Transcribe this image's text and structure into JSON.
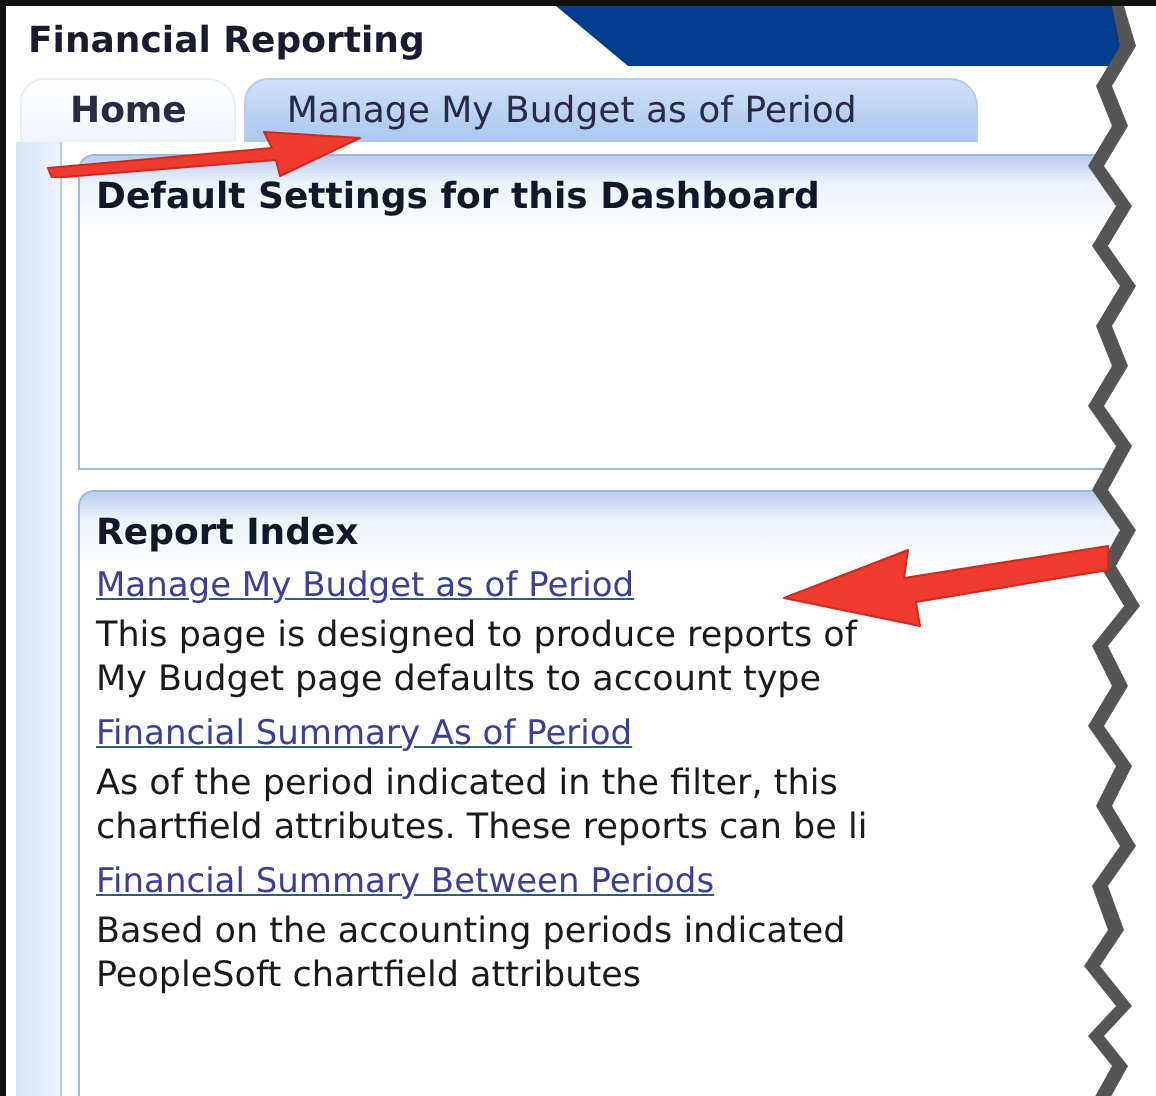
{
  "window": {
    "title": "Financial Reporting"
  },
  "tabs": [
    {
      "label": "Home",
      "selected": true
    },
    {
      "label": "Manage My Budget as of Period",
      "selected": false
    }
  ],
  "settings_panel": {
    "title": "Default Settings for this Dashboard"
  },
  "report_index": {
    "title": "Report Index",
    "reports": [
      {
        "link": "Manage My Budget as of Period",
        "description": [
          "This page is designed to produce reports of",
          "My Budget page defaults to account type"
        ]
      },
      {
        "link": "Financial Summary As of Period",
        "description": [
          "As of the period indicated in the filter, this",
          "chartfield attributes. These reports can be li"
        ]
      },
      {
        "link": "Financial Summary Between Periods",
        "description": [
          "Based on the accounting periods indicated",
          "PeopleSoft chartfield attributes"
        ]
      }
    ]
  }
}
